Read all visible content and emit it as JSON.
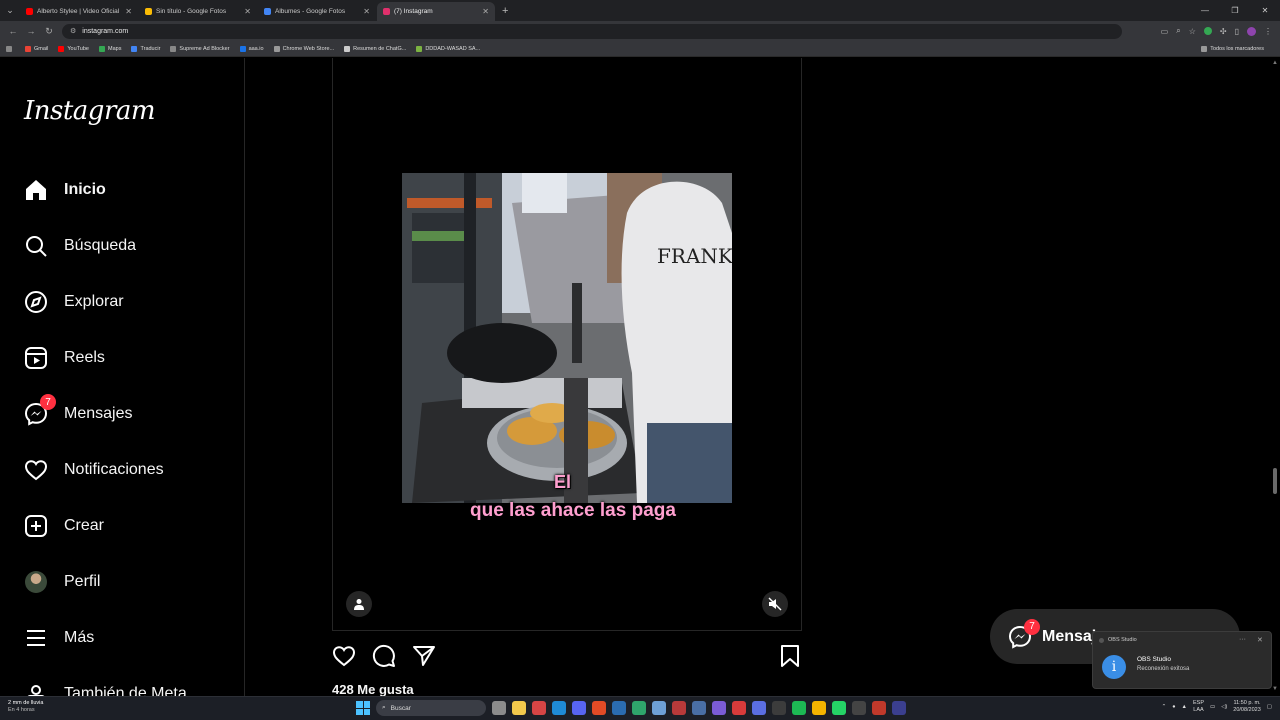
{
  "browser": {
    "tabs": [
      {
        "title": "Alberto Stylee | Video Oficial |",
        "favicon_color": "#ff0000",
        "active": false
      },
      {
        "title": "Sin título - Google Fotos",
        "favicon_color": "#fbbc05",
        "active": false
      },
      {
        "title": "Álbumes - Google Fotos",
        "favicon_color": "#4285f4",
        "active": false
      },
      {
        "title": "(7) Instagram",
        "favicon_color": "#e1306c",
        "active": true
      }
    ],
    "new_tab_icon": "plus-icon",
    "url": "instagram.com",
    "bookmarks": [
      {
        "label": "Gmail",
        "color": "#ea4335"
      },
      {
        "label": "YouTube",
        "color": "#ff0000"
      },
      {
        "label": "Maps",
        "color": "#34a853"
      },
      {
        "label": "Traducir",
        "color": "#4285f4"
      },
      {
        "label": "Supreme Ad Blocker",
        "color": "#888888"
      },
      {
        "label": "aaa.io",
        "color": "#1a73e8"
      },
      {
        "label": "Chrome Web Store...",
        "color": "#999999"
      },
      {
        "label": "Resumen de ChatG...",
        "color": "#cccccc"
      },
      {
        "label": "DDDAD-WASAD SA...",
        "color": "#7cb342"
      }
    ],
    "all_bookmarks": "Todos los marcadores"
  },
  "instagram": {
    "logo": "Instagram",
    "nav": [
      {
        "label": "Inicio",
        "icon": "home-icon",
        "bold": true
      },
      {
        "label": "Búsqueda",
        "icon": "search-icon"
      },
      {
        "label": "Explorar",
        "icon": "compass-icon"
      },
      {
        "label": "Reels",
        "icon": "reels-icon"
      },
      {
        "label": "Mensajes",
        "icon": "messenger-icon",
        "badge": "7"
      },
      {
        "label": "Notificaciones",
        "icon": "heart-icon"
      },
      {
        "label": "Crear",
        "icon": "plus-square-icon"
      },
      {
        "label": "Perfil",
        "icon": "avatar"
      },
      {
        "label": "Más",
        "icon": "menu-icon"
      },
      {
        "label": "También de Meta",
        "icon": "meta-icon"
      }
    ],
    "post": {
      "caption_line1": "El",
      "caption_line2": "que las ahace las paga",
      "hoodie_text": "FRANK",
      "likes": "428 Me gusta"
    },
    "messages_float": {
      "label": "Mensajes",
      "badge": "7"
    }
  },
  "notification": {
    "app": "OBS Studio",
    "title": "OBS Studio",
    "body": "Reconexión exitosa"
  },
  "taskbar": {
    "weather_line1": "2 mm de lluvia",
    "weather_line2": "En 4 horas",
    "search_placeholder": "Buscar",
    "lang_line1": "ESP",
    "lang_line2": "LAA",
    "time": "11:50 p. m.",
    "date": "20/08/2023"
  }
}
